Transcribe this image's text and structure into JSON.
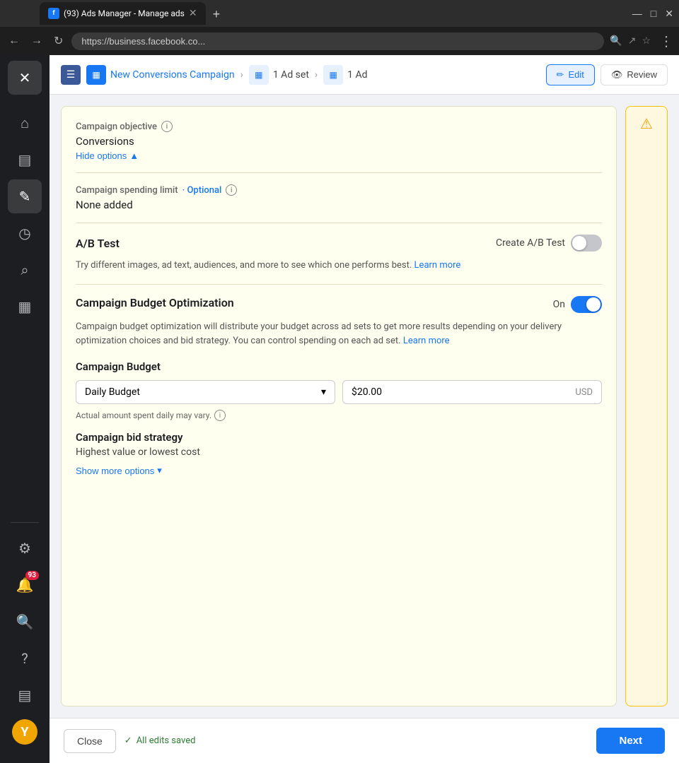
{
  "browser": {
    "tab_title": "(93) Ads Manager - Manage ads",
    "tab_favicon": "f",
    "address": "https://business.facebook.co...",
    "new_tab_icon": "+"
  },
  "breadcrumb": {
    "campaign_label": "New Conversions Campaign",
    "adset_label": "1 Ad set",
    "ad_label": "1 Ad"
  },
  "toolbar": {
    "edit_label": "Edit",
    "review_label": "Review"
  },
  "campaign_section": {
    "objective_label": "Campaign objective",
    "objective_value": "Conversions",
    "hide_options_label": "Hide options",
    "spending_limit_label": "Campaign spending limit",
    "spending_limit_optional": "· Optional",
    "spending_limit_value": "None added"
  },
  "ab_test": {
    "title": "A/B Test",
    "toggle_label": "Create A/B Test",
    "toggle_state": "off",
    "description": "Try different images, ad text, audiences, and more to see which one performs best.",
    "learn_more_label": "Learn more"
  },
  "cbo": {
    "title": "Campaign Budget Optimization",
    "toggle_state": "on",
    "toggle_label": "On",
    "description": "Campaign budget optimization will distribute your budget across ad sets to get more results depending on your delivery optimization choices and bid strategy. You can control spending on each ad set.",
    "learn_more_label": "Learn more"
  },
  "budget": {
    "title": "Campaign Budget",
    "type_label": "Daily Budget",
    "amount_value": "$20.00",
    "currency": "USD",
    "note": "Actual amount spent daily may vary.",
    "dropdown_arrow": "▾"
  },
  "bid_strategy": {
    "label": "Campaign bid strategy",
    "value": "Highest value or lowest cost",
    "show_more_label": "Show more options",
    "show_more_arrow": "▾"
  },
  "bottom_bar": {
    "close_label": "Close",
    "saved_label": "All edits saved",
    "next_label": "Next"
  },
  "sidebar": {
    "home_icon": "⌂",
    "chart_icon": "▤",
    "edit_icon": "✎",
    "clock_icon": "◷",
    "search_icon": "⌕",
    "grid_icon": "▦",
    "settings_icon": "⚙",
    "bell_badge": "93",
    "search2_icon": "🔍",
    "help_icon": "?",
    "panel_icon": "▤",
    "user_letter": "Y"
  },
  "warning_panel": {
    "icon": "⚠"
  }
}
